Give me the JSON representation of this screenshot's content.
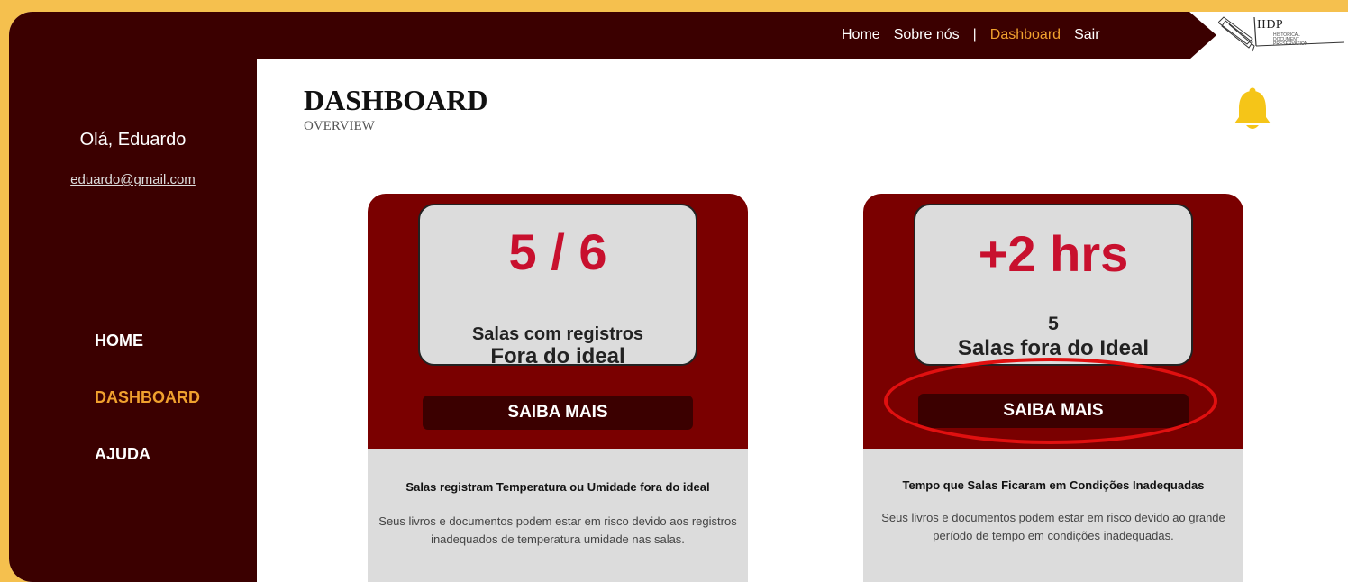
{
  "nav": {
    "home": "Home",
    "about": "Sobre nós",
    "separator": "|",
    "dashboard": "Dashboard",
    "logout": "Sair"
  },
  "logo": {
    "text": "IIDP",
    "subtitle": "HISTORICAL DOCUMENT PRESERVATION"
  },
  "user": {
    "greeting": "Olá, Eduardo",
    "email": "eduardo@gmail.com"
  },
  "sidebar": {
    "items": [
      {
        "label": "HOME"
      },
      {
        "label": "DASHBOARD",
        "active": true
      },
      {
        "label": "AJUDA"
      }
    ]
  },
  "page": {
    "title": "DASHBOARD",
    "subtitle": "OVERVIEW"
  },
  "icons": {
    "notification": "bell-icon"
  },
  "cards": [
    {
      "value": "5 / 6",
      "line1": "Salas com registros",
      "line2": "Fora do ideal",
      "button": "SAIBA MAIS",
      "title": "Salas registram Temperatura ou Umidade fora do ideal",
      "description": "Seus livros e documentos podem estar em risco devido aos registros inadequados de temperatura umidade nas salas."
    },
    {
      "value": "+2 hrs",
      "line1": "5",
      "line2": "Salas fora do Ideal",
      "button": "SAIBA MAIS",
      "title": "Tempo que Salas Ficaram em Condições Inadequadas",
      "description": "Seus livros e documentos podem estar em risco devido ao grande período de tempo em condições inadequadas."
    }
  ],
  "colors": {
    "background": "#f5c04e",
    "dark": "#3b0000",
    "card_red": "#7a0000",
    "accent": "#f0a12e",
    "value_red": "#c8102e",
    "highlight": "#e01010",
    "bell": "#f5c518"
  }
}
